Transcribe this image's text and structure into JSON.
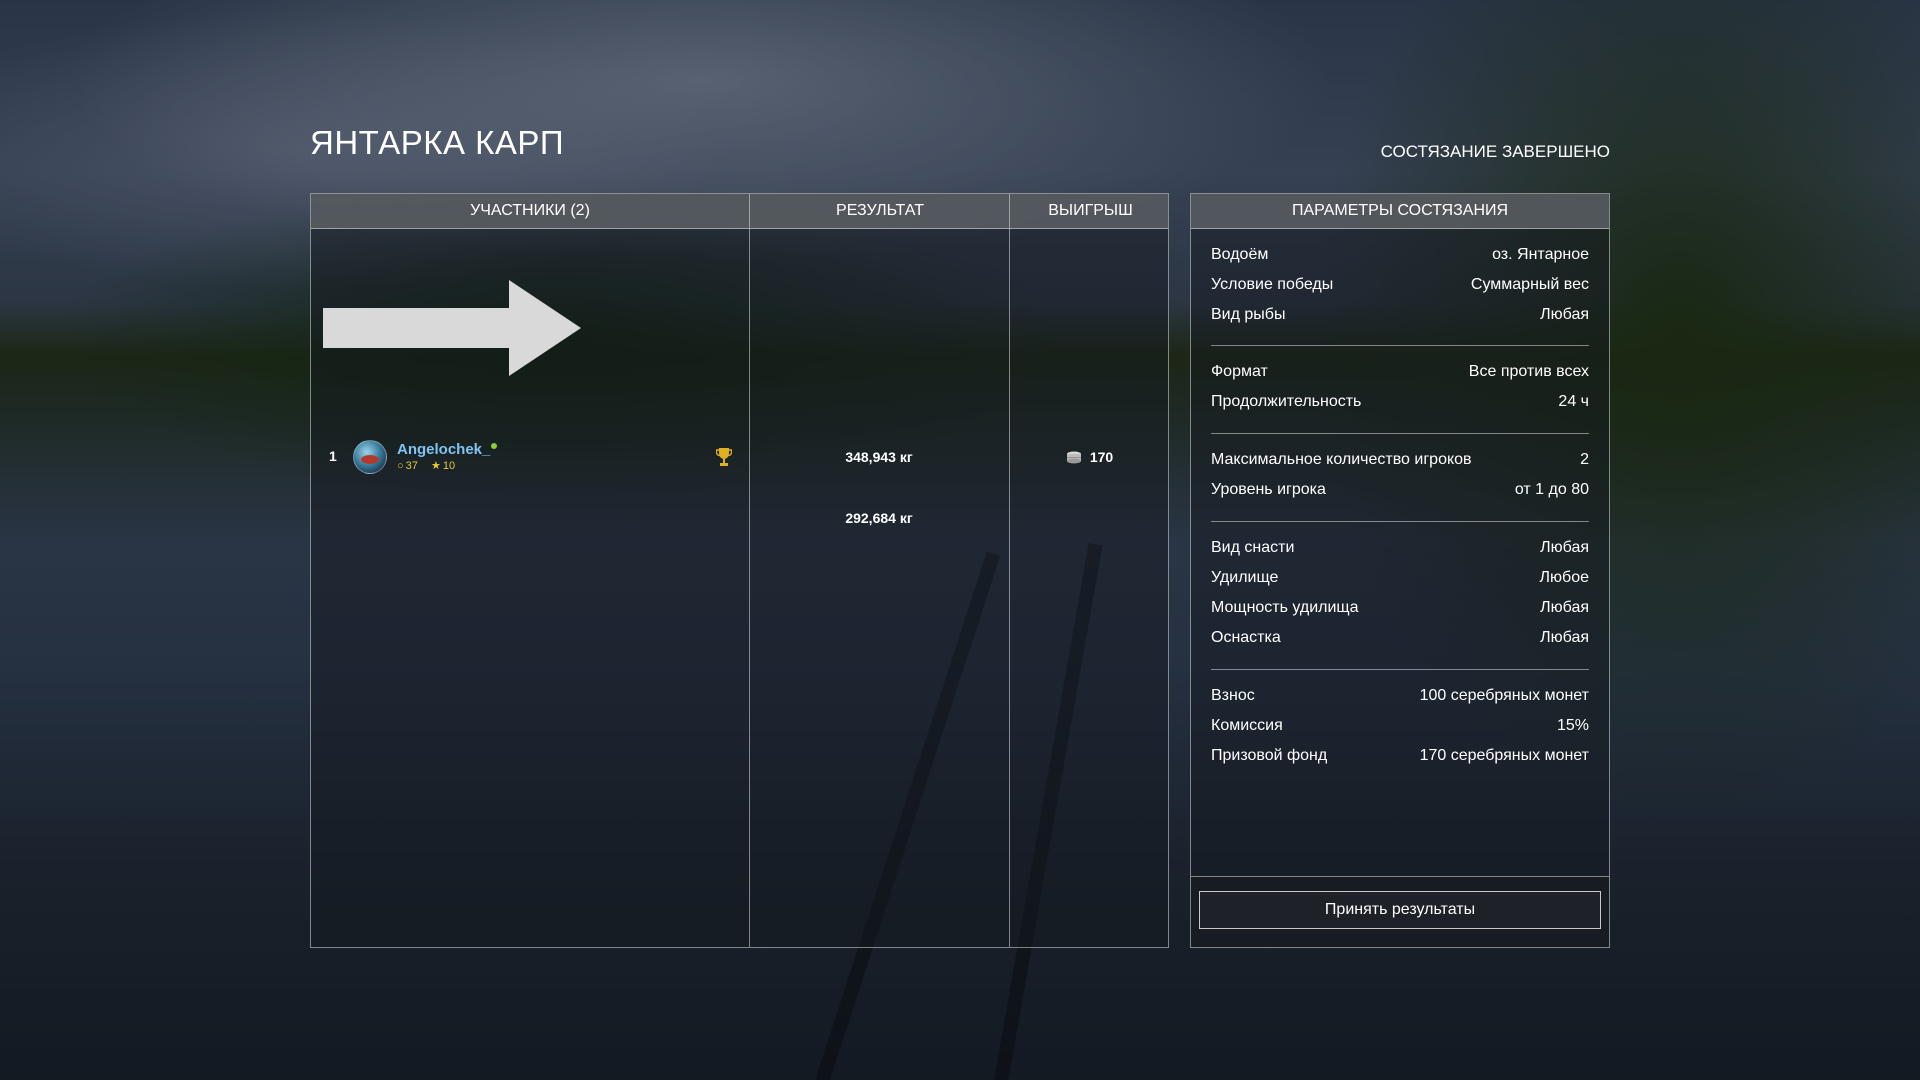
{
  "header": {
    "title": "ЯНТАРКА КАРП",
    "status": "СОСТЯЗАНИЕ ЗАВЕРШЕНО"
  },
  "results_table": {
    "columns": {
      "participants": "УЧАСТНИКИ (2)",
      "result": "РЕЗУЛЬТАТ",
      "prize": "ВЫИГРЫШ"
    },
    "rows": [
      {
        "rank": "1",
        "name": "Angelochek_",
        "level": "37",
        "rating": "10",
        "result": "348,943 кг",
        "prize": "170"
      },
      {
        "rank": "",
        "name": "",
        "result": "292,684 кг",
        "prize": ""
      }
    ]
  },
  "params": {
    "title": "ПАРАМЕТРЫ СОСТЯЗАНИЯ",
    "groups": [
      [
        {
          "key": "Водоём",
          "value": "оз. Янтарное"
        },
        {
          "key": "Условие победы",
          "value": "Суммарный вес"
        },
        {
          "key": "Вид рыбы",
          "value": "Любая"
        }
      ],
      [
        {
          "key": "Формат",
          "value": "Все против всех"
        },
        {
          "key": "Продолжительность",
          "value": "24 ч"
        }
      ],
      [
        {
          "key": "Максимальное количество игроков",
          "value": "2"
        },
        {
          "key": "Уровень игрока",
          "value": "от 1 до 80"
        }
      ],
      [
        {
          "key": "Вид снасти",
          "value": "Любая"
        },
        {
          "key": "Удилище",
          "value": "Любое"
        },
        {
          "key": "Мощность удилища",
          "value": "Любая"
        },
        {
          "key": "Оснастка",
          "value": "Любая"
        }
      ],
      [
        {
          "key": "Взнос",
          "value": "100 серебряных монет"
        },
        {
          "key": "Комиссия",
          "value": "15%"
        },
        {
          "key": "Призовой фонд",
          "value": "170 серебряных монет"
        }
      ]
    ],
    "accept_label": "Принять результаты"
  },
  "icons": {
    "level": "level-circle-icon",
    "rating": "star-icon",
    "winner": "trophy-icon",
    "prize": "silver-coins-icon"
  },
  "colors": {
    "player_name": "#7fc4f2",
    "stats": "#e9c93a",
    "online": "#8ccf3c",
    "trophy": "#e0b020"
  }
}
